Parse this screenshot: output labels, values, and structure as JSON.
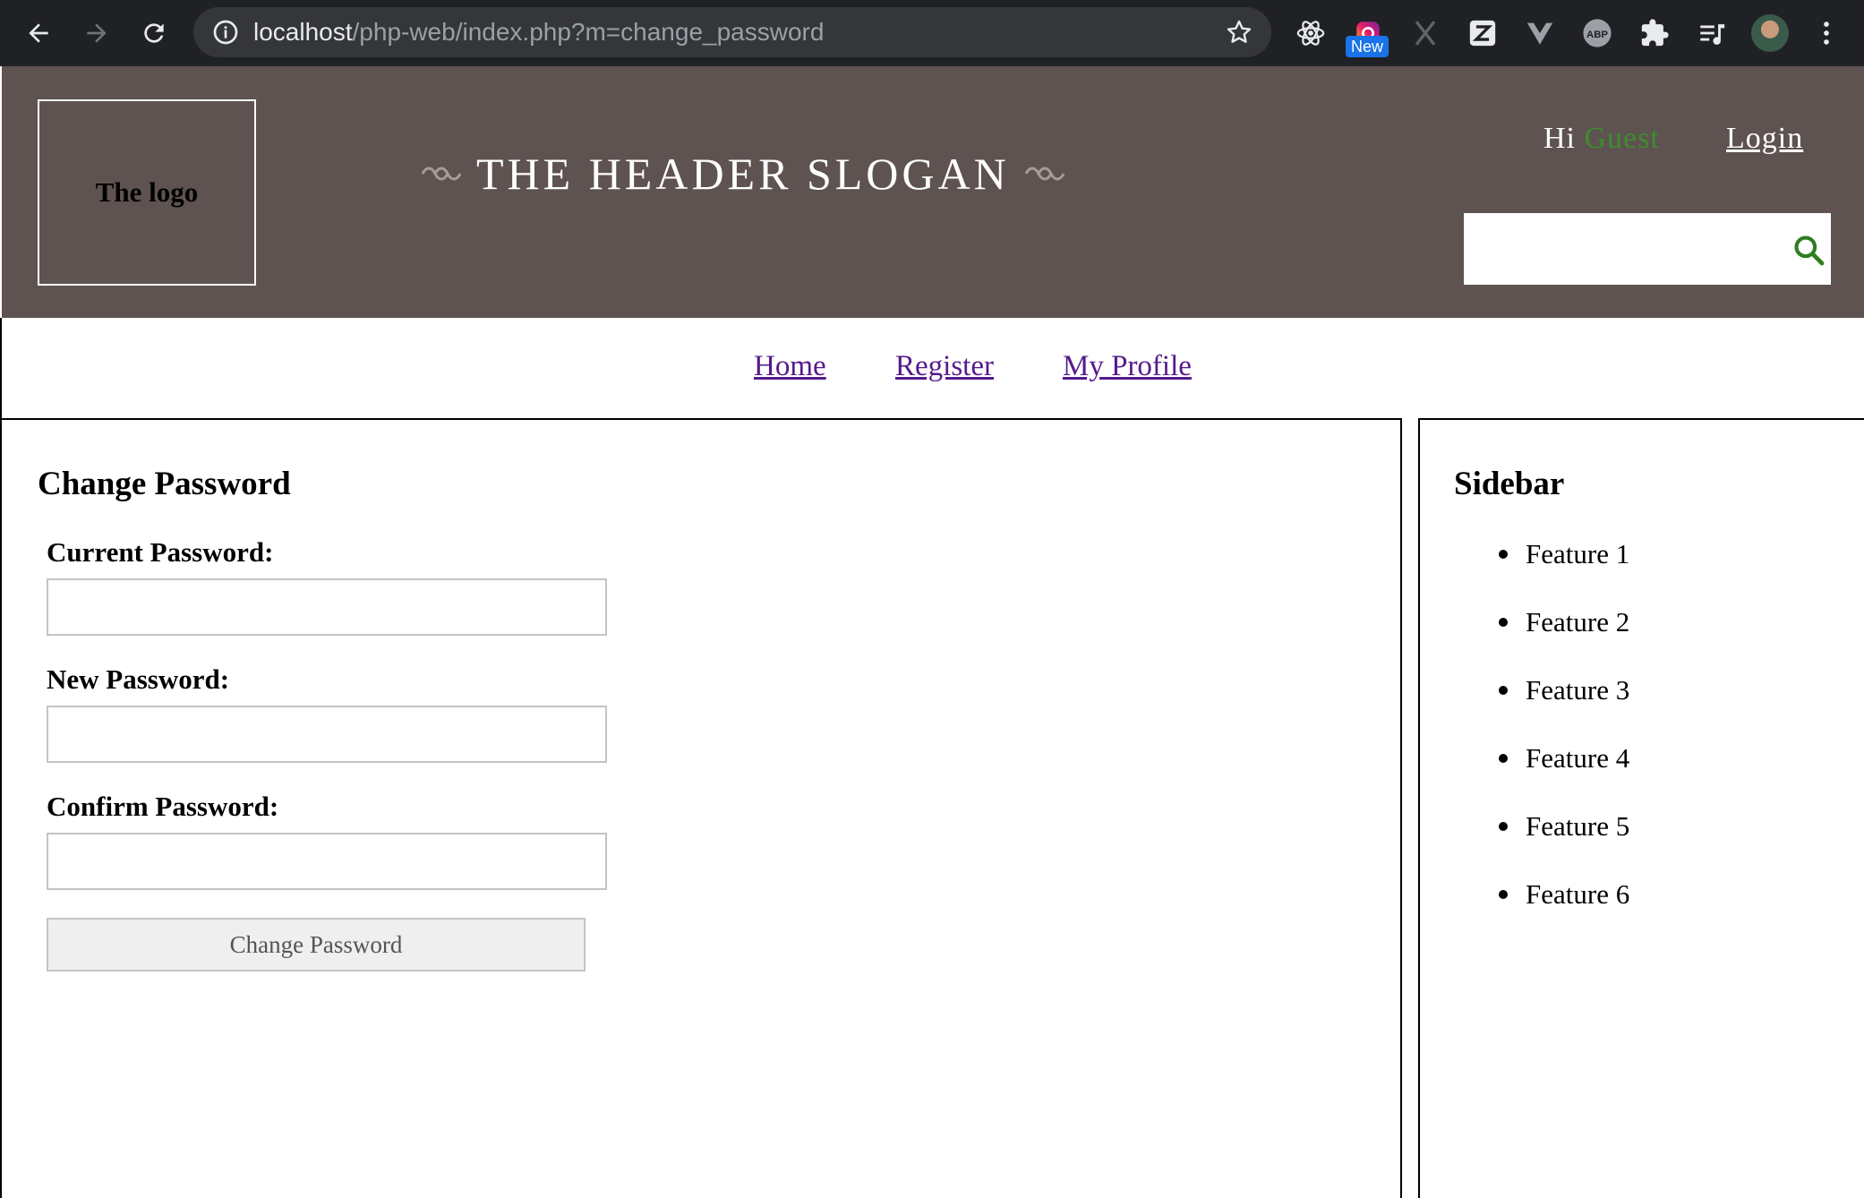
{
  "browser": {
    "url_host": "localhost",
    "url_path": "/php-web/index.php?m=change_password",
    "extension_badge": "New"
  },
  "header": {
    "logo_text": "The logo",
    "slogan": "THE HEADER SLOGAN",
    "greeting_prefix": "Hi",
    "greeting_user": "Guest",
    "login_label": "Login",
    "search_value": "",
    "colors": {
      "header_bg": "#5e5350",
      "guest_accent": "#3c8d2f"
    }
  },
  "nav": {
    "items": [
      {
        "label": "Home"
      },
      {
        "label": "Register"
      },
      {
        "label": "My Profile"
      }
    ]
  },
  "main": {
    "title": "Change Password",
    "fields": [
      {
        "label": "Current Password:",
        "value": ""
      },
      {
        "label": "New Password:",
        "value": ""
      },
      {
        "label": "Confirm Password:",
        "value": ""
      }
    ],
    "submit_label": "Change Password"
  },
  "sidebar": {
    "title": "Sidebar",
    "items": [
      {
        "label": "Feature 1"
      },
      {
        "label": "Feature 2"
      },
      {
        "label": "Feature 3"
      },
      {
        "label": "Feature 4"
      },
      {
        "label": "Feature 5"
      },
      {
        "label": "Feature 6"
      }
    ]
  }
}
